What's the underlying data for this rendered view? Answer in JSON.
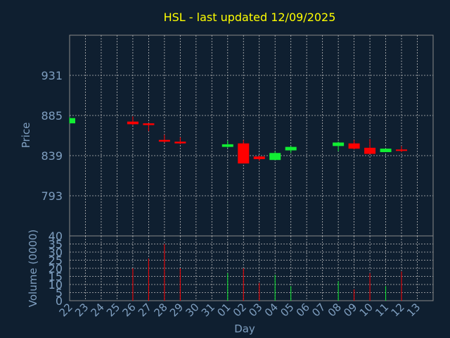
{
  "chart_data": {
    "type": "candlestick",
    "title": "HSL - last updated 12/09/2025",
    "xlabel": "Day",
    "price_panel": {
      "ylabel": "Price",
      "ylim": [
        747,
        977
      ],
      "yticks": [
        793,
        839,
        885,
        931
      ],
      "grid": true
    },
    "volume_panel": {
      "ylabel": "Volume (0000)",
      "ylim": [
        0,
        40
      ],
      "yticks": [
        0,
        5,
        10,
        15,
        20,
        25,
        30,
        35,
        40
      ],
      "grid": true
    },
    "x_tick_labels": [
      "22",
      "23",
      "24",
      "25",
      "26",
      "27",
      "28",
      "29",
      "30",
      "31",
      "01",
      "02",
      "03",
      "04",
      "05",
      "06",
      "07",
      "08",
      "09",
      "10",
      "11",
      "12",
      "13"
    ],
    "candles": [
      {
        "day": "22",
        "open": 876,
        "close": 882,
        "high": 883,
        "low": 876,
        "volume": 0
      },
      {
        "day": "26",
        "open": 878,
        "close": 875,
        "high": 884,
        "low": 874,
        "volume": 20
      },
      {
        "day": "27",
        "open": 876,
        "close": 874,
        "high": 876,
        "low": 867,
        "volume": 26
      },
      {
        "day": "28",
        "open": 857,
        "close": 855,
        "high": 863,
        "low": 854,
        "volume": 35
      },
      {
        "day": "29",
        "open": 855,
        "close": 853,
        "high": 860,
        "low": 852,
        "volume": 20
      },
      {
        "day": "01",
        "open": 849,
        "close": 852,
        "high": 856,
        "low": 848,
        "volume": 17
      },
      {
        "day": "02",
        "open": 853,
        "close": 830,
        "high": 857,
        "low": 830,
        "volume": 20
      },
      {
        "day": "03",
        "open": 838,
        "close": 835,
        "high": 839,
        "low": 833,
        "volume": 11
      },
      {
        "day": "04",
        "open": 834,
        "close": 842,
        "high": 844,
        "low": 834,
        "volume": 16
      },
      {
        "day": "05",
        "open": 845,
        "close": 849,
        "high": 850,
        "low": 842,
        "volume": 9
      },
      {
        "day": "08",
        "open": 850,
        "close": 854,
        "high": 855,
        "low": 844,
        "volume": 12
      },
      {
        "day": "09",
        "open": 853,
        "close": 847,
        "high": 857,
        "low": 846,
        "volume": 7
      },
      {
        "day": "10",
        "open": 848,
        "close": 841,
        "high": 858,
        "low": 841,
        "volume": 17
      },
      {
        "day": "11",
        "open": 843,
        "close": 847,
        "high": 847,
        "low": 843,
        "volume": 9
      },
      {
        "day": "12",
        "open": 846,
        "close": 845,
        "high": 850,
        "low": 843,
        "volume": 18
      }
    ],
    "colors": {
      "background": "#0f1f30",
      "up": "#11ee33",
      "down": "#ff0000",
      "grid": "#bbbbbb",
      "axis_text": "#7f9fc0",
      "title": "#ffff00"
    }
  }
}
